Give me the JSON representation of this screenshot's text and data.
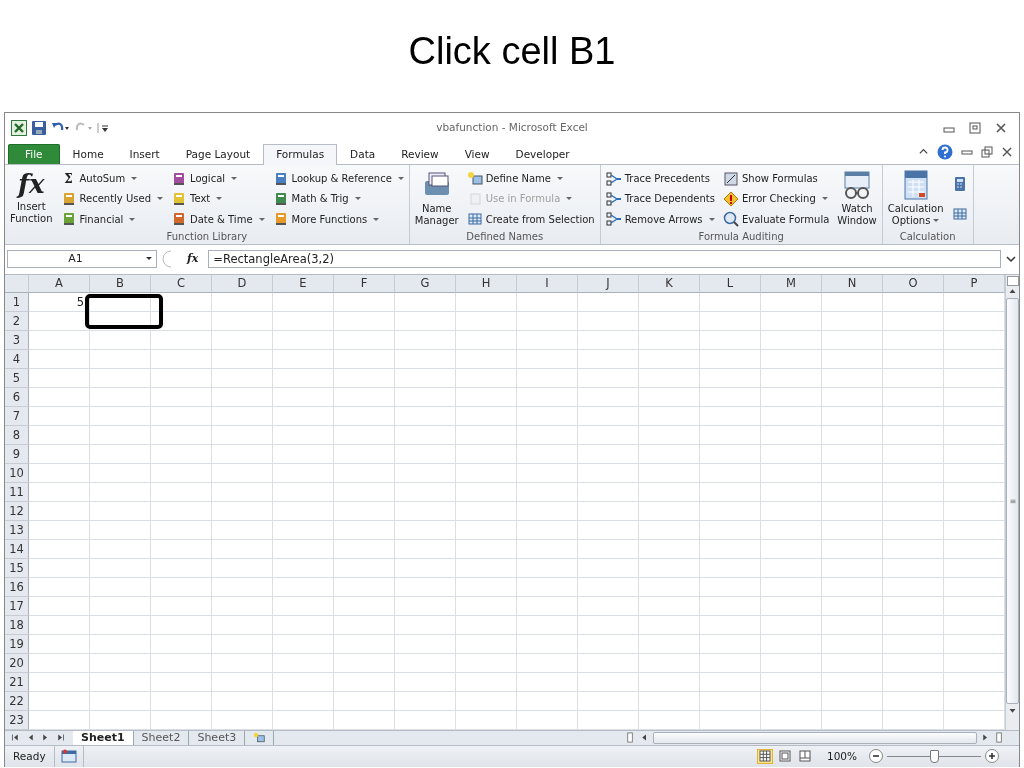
{
  "slide_title": "Click cell B1",
  "window": {
    "title": "vbafunction  -  Microsoft Excel"
  },
  "tabs": [
    {
      "label": "File",
      "kind": "file",
      "selected": false
    },
    {
      "label": "Home",
      "kind": "tab",
      "selected": false
    },
    {
      "label": "Insert",
      "kind": "tab",
      "selected": false
    },
    {
      "label": "Page Layout",
      "kind": "tab",
      "selected": false
    },
    {
      "label": "Formulas",
      "kind": "tab",
      "selected": true
    },
    {
      "label": "Data",
      "kind": "tab",
      "selected": false
    },
    {
      "label": "Review",
      "kind": "tab",
      "selected": false
    },
    {
      "label": "View",
      "kind": "tab",
      "selected": false
    },
    {
      "label": "Developer",
      "kind": "tab",
      "selected": false
    }
  ],
  "ribbon_groups": [
    {
      "label": "Function Library",
      "items": [
        {
          "kind": "large",
          "glyph": "fx",
          "label": "Insert Function",
          "dropdown": false,
          "disabled": false
        },
        {
          "kind": "small",
          "glyph": "Σ",
          "label": "AutoSum",
          "dropdown": true,
          "disabled": false
        },
        {
          "kind": "small",
          "label": "Recently Used",
          "dropdown": true,
          "disabled": false
        },
        {
          "kind": "small",
          "label": "Financial",
          "dropdown": true,
          "disabled": false
        },
        {
          "kind": "small",
          "label": "Logical",
          "dropdown": true,
          "disabled": false
        },
        {
          "kind": "small",
          "label": "Text",
          "dropdown": true,
          "disabled": false
        },
        {
          "kind": "small",
          "label": "Date & Time",
          "dropdown": true,
          "disabled": false
        },
        {
          "kind": "small",
          "label": "Lookup & Reference",
          "dropdown": true,
          "disabled": false
        },
        {
          "kind": "small",
          "label": "Math & Trig",
          "dropdown": true,
          "disabled": false
        },
        {
          "kind": "small",
          "label": "More Functions",
          "dropdown": true,
          "disabled": false
        }
      ]
    },
    {
      "label": "Defined Names",
      "items": [
        {
          "kind": "large",
          "label": "Name Manager",
          "dropdown": false,
          "disabled": false
        },
        {
          "kind": "small",
          "label": "Define Name",
          "dropdown": true,
          "disabled": false
        },
        {
          "kind": "small",
          "label": "Use in Formula",
          "dropdown": true,
          "disabled": true
        },
        {
          "kind": "small",
          "label": "Create from Selection",
          "dropdown": false,
          "disabled": false
        }
      ]
    },
    {
      "label": "Formula Auditing",
      "items": [
        {
          "kind": "small",
          "label": "Trace Precedents",
          "dropdown": false,
          "disabled": false
        },
        {
          "kind": "small",
          "label": "Trace Dependents",
          "dropdown": false,
          "disabled": false
        },
        {
          "kind": "small",
          "label": "Remove Arrows",
          "dropdown": true,
          "disabled": false
        },
        {
          "kind": "small",
          "label": "Show Formulas",
          "dropdown": false,
          "disabled": false
        },
        {
          "kind": "small",
          "label": "Error Checking",
          "dropdown": true,
          "disabled": false
        },
        {
          "kind": "small",
          "label": "Evaluate Formula",
          "dropdown": false,
          "disabled": false
        },
        {
          "kind": "large",
          "label": "Watch Window",
          "dropdown": false,
          "disabled": false
        }
      ]
    },
    {
      "label": "Calculation",
      "items": [
        {
          "kind": "large",
          "label": "Calculation Options",
          "dropdown": true,
          "disabled": false
        },
        {
          "kind": "small",
          "dropdown": false,
          "disabled": false
        },
        {
          "kind": "small",
          "dropdown": false,
          "disabled": false
        }
      ]
    }
  ],
  "formula_bar": {
    "name_box": "A1",
    "fx": "fx",
    "formula": "=RectangleArea(3,2)"
  },
  "columns": [
    "A",
    "B",
    "C",
    "D",
    "E",
    "F",
    "G",
    "H",
    "I",
    "J",
    "K",
    "L",
    "M",
    "N",
    "O",
    "P"
  ],
  "rows": [
    {
      "label": "1",
      "cells": [
        "5"
      ]
    },
    {
      "label": "2"
    },
    {
      "label": "3"
    },
    {
      "label": "4"
    },
    {
      "label": "5"
    },
    {
      "label": "6"
    },
    {
      "label": "7"
    },
    {
      "label": "8"
    },
    {
      "label": "9"
    },
    {
      "label": "10"
    },
    {
      "label": "11"
    },
    {
      "label": "12"
    },
    {
      "label": "13"
    },
    {
      "label": "14"
    },
    {
      "label": "15"
    },
    {
      "label": "16"
    },
    {
      "label": "17"
    },
    {
      "label": "18"
    },
    {
      "label": "19"
    },
    {
      "label": "20"
    },
    {
      "label": "21"
    },
    {
      "label": "22"
    },
    {
      "label": "23"
    }
  ],
  "sheet_tabs": [
    {
      "label": "Sheet1",
      "selected": true
    },
    {
      "label": "Sheet2",
      "selected": false
    },
    {
      "label": "Sheet3",
      "selected": false
    }
  ],
  "status_bar": {
    "status": "Ready",
    "views": [
      {
        "kind": "normal",
        "selected": true
      },
      {
        "kind": "page-layout",
        "selected": false
      },
      {
        "kind": "page-break",
        "selected": false
      }
    ],
    "zoom": "100%",
    "zoom_slider": {
      "level": 0.5
    }
  }
}
